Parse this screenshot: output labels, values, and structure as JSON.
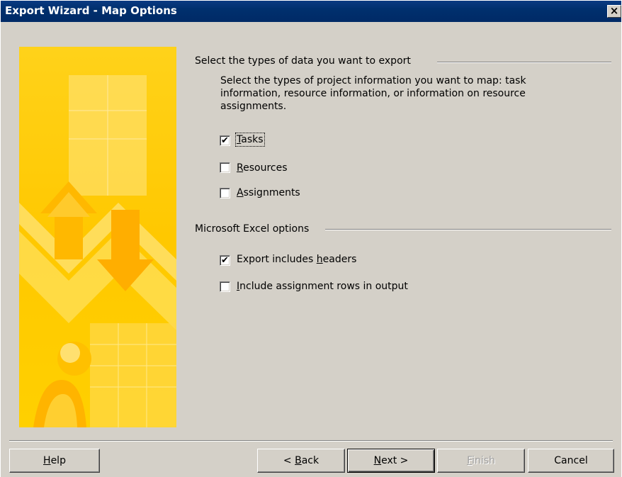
{
  "window": {
    "title": "Export Wizard - Map Options",
    "close_glyph": "×"
  },
  "group_data": {
    "title": "Select the types of data you want to export",
    "description": "Select the types of project information you want to map: task information, resource information, or information on resource assignments.",
    "options": [
      {
        "label_pre": "",
        "mnemonic": "T",
        "label_post": "asks",
        "checked": true
      },
      {
        "label_pre": "",
        "mnemonic": "R",
        "label_post": "esources",
        "checked": false
      },
      {
        "label_pre": "",
        "mnemonic": "A",
        "label_post": "ssignments",
        "checked": false
      }
    ]
  },
  "group_excel": {
    "title": "Microsoft Excel options",
    "options": [
      {
        "label_pre": "Export includes ",
        "mnemonic": "h",
        "label_post": "eaders",
        "checked": true
      },
      {
        "label_pre": "",
        "mnemonic": "I",
        "label_post": "nclude assignment rows in output",
        "checked": false
      }
    ]
  },
  "buttons": {
    "help": {
      "pre": "",
      "mnemonic": "H",
      "post": "elp"
    },
    "back": {
      "pre": "< ",
      "mnemonic": "B",
      "post": "ack"
    },
    "next": {
      "pre": "",
      "mnemonic": "N",
      "post": "ext >"
    },
    "finish": {
      "pre": "",
      "mnemonic": "F",
      "post": "inish",
      "disabled": true
    },
    "cancel": {
      "pre": "Cancel",
      "mnemonic": "",
      "post": ""
    }
  },
  "check_glyph": "✔",
  "colors": {
    "titlebar": "#002c6e",
    "face": "#d4d0c8",
    "art": "#ffcc00"
  }
}
